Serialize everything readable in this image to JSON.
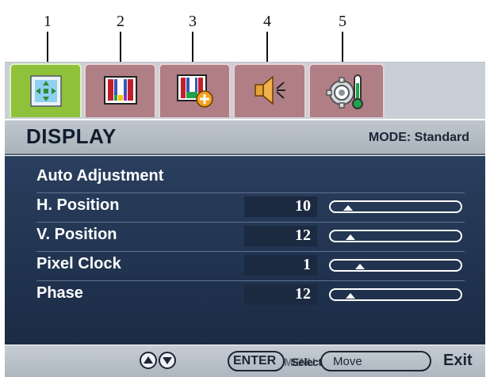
{
  "tab_numbers": [
    "1",
    "2",
    "3",
    "4",
    "5"
  ],
  "tabs": [
    {
      "icon": "display-adjust-icon",
      "active": true
    },
    {
      "icon": "picture-icon",
      "active": false
    },
    {
      "icon": "picture-advanced-icon",
      "active": false
    },
    {
      "icon": "speaker-icon",
      "active": false
    },
    {
      "icon": "system-gear-icon",
      "active": false
    }
  ],
  "header": {
    "title": "DISPLAY",
    "mode_label": "MODE: Standard"
  },
  "menu": {
    "auto_adjust": "Auto Adjustment",
    "items": [
      {
        "label": "H. Position",
        "value": "10",
        "slider_fraction": 0.1
      },
      {
        "label": "V. Position",
        "value": "12",
        "slider_fraction": 0.12
      },
      {
        "label": "Pixel Clock",
        "value": "1",
        "slider_fraction": 0.2
      },
      {
        "label": "Phase",
        "value": "12",
        "slider_fraction": 0.12
      }
    ]
  },
  "footer": {
    "up_icon": "arrow-up-icon",
    "down_icon": "arrow-down-icon",
    "enter_label": "ENTER",
    "menu_label": "MENU",
    "select_label": "Select",
    "move_label": "Move",
    "exit_label": "Exit"
  },
  "colors": {
    "active_tab": "#8fc23a",
    "inactive_tab": "#b07e85",
    "panel": "#22344f"
  }
}
